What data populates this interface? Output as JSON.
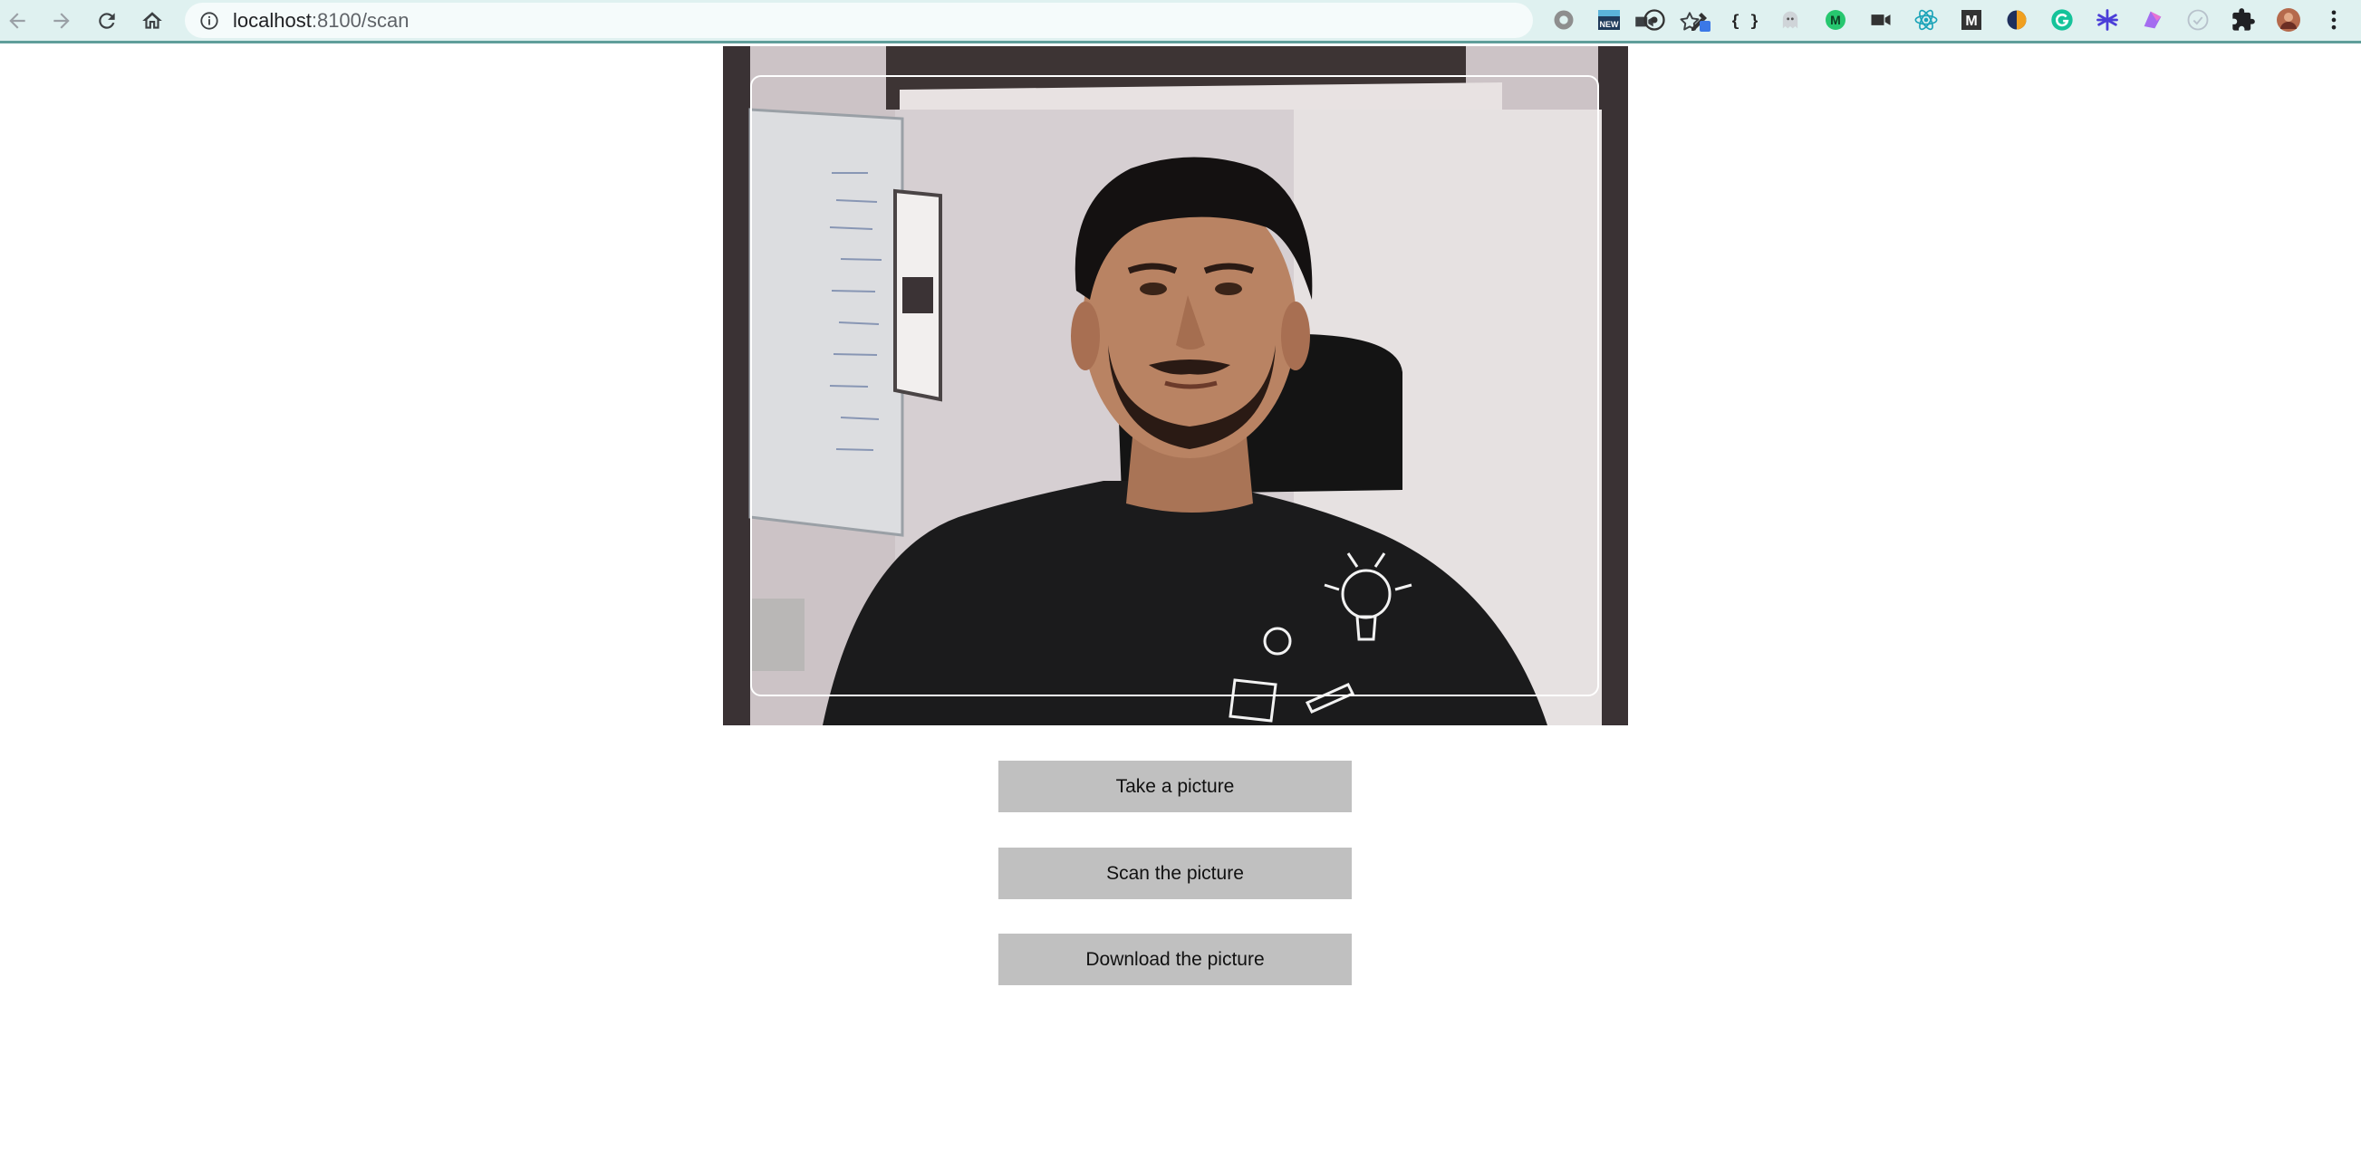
{
  "browser": {
    "url_host": "localhost",
    "url_rest": ":8100/scan",
    "nav": {
      "back_icon": "arrow-left-icon",
      "forward_icon": "arrow-right-icon",
      "reload_icon": "reload-icon",
      "home_icon": "home-icon"
    },
    "omnibox_icons": [
      "site-info-icon",
      "camera-icon",
      "bookmark-star-icon"
    ],
    "extensions": [
      "gear-extension-icon",
      "new-badge-extension-icon",
      "circle-extension-icon",
      "eyedropper-extension-icon",
      "json-braces-extension-icon",
      "ghost-extension-icon",
      "m-green-extension-icon",
      "video-camera-extension-icon",
      "react-extension-icon",
      "m-extension-icon",
      "halfmoon-extension-icon",
      "grammarly-extension-icon",
      "asterisk-extension-icon",
      "palette-extension-icon",
      "check-circle-extension-icon",
      "puzzle-extensions-icon",
      "profile-avatar",
      "kebab-menu-icon"
    ],
    "extension_labels": {
      "new_badge": "NEW",
      "json": "{ }",
      "m": "M"
    },
    "colors": {
      "toolbar_bg": "#dff1f0",
      "toolbar_border": "#5f9e9a",
      "omnibox_bg": "#f5fbfb"
    }
  },
  "scanner": {
    "video_frame_bg": "#2f2a2c",
    "scan_box_border": "#ffffff",
    "buttons": {
      "take": "Take a picture",
      "scan": "Scan the picture",
      "download": "Download the picture"
    },
    "button_bg": "#c0c0c0"
  }
}
